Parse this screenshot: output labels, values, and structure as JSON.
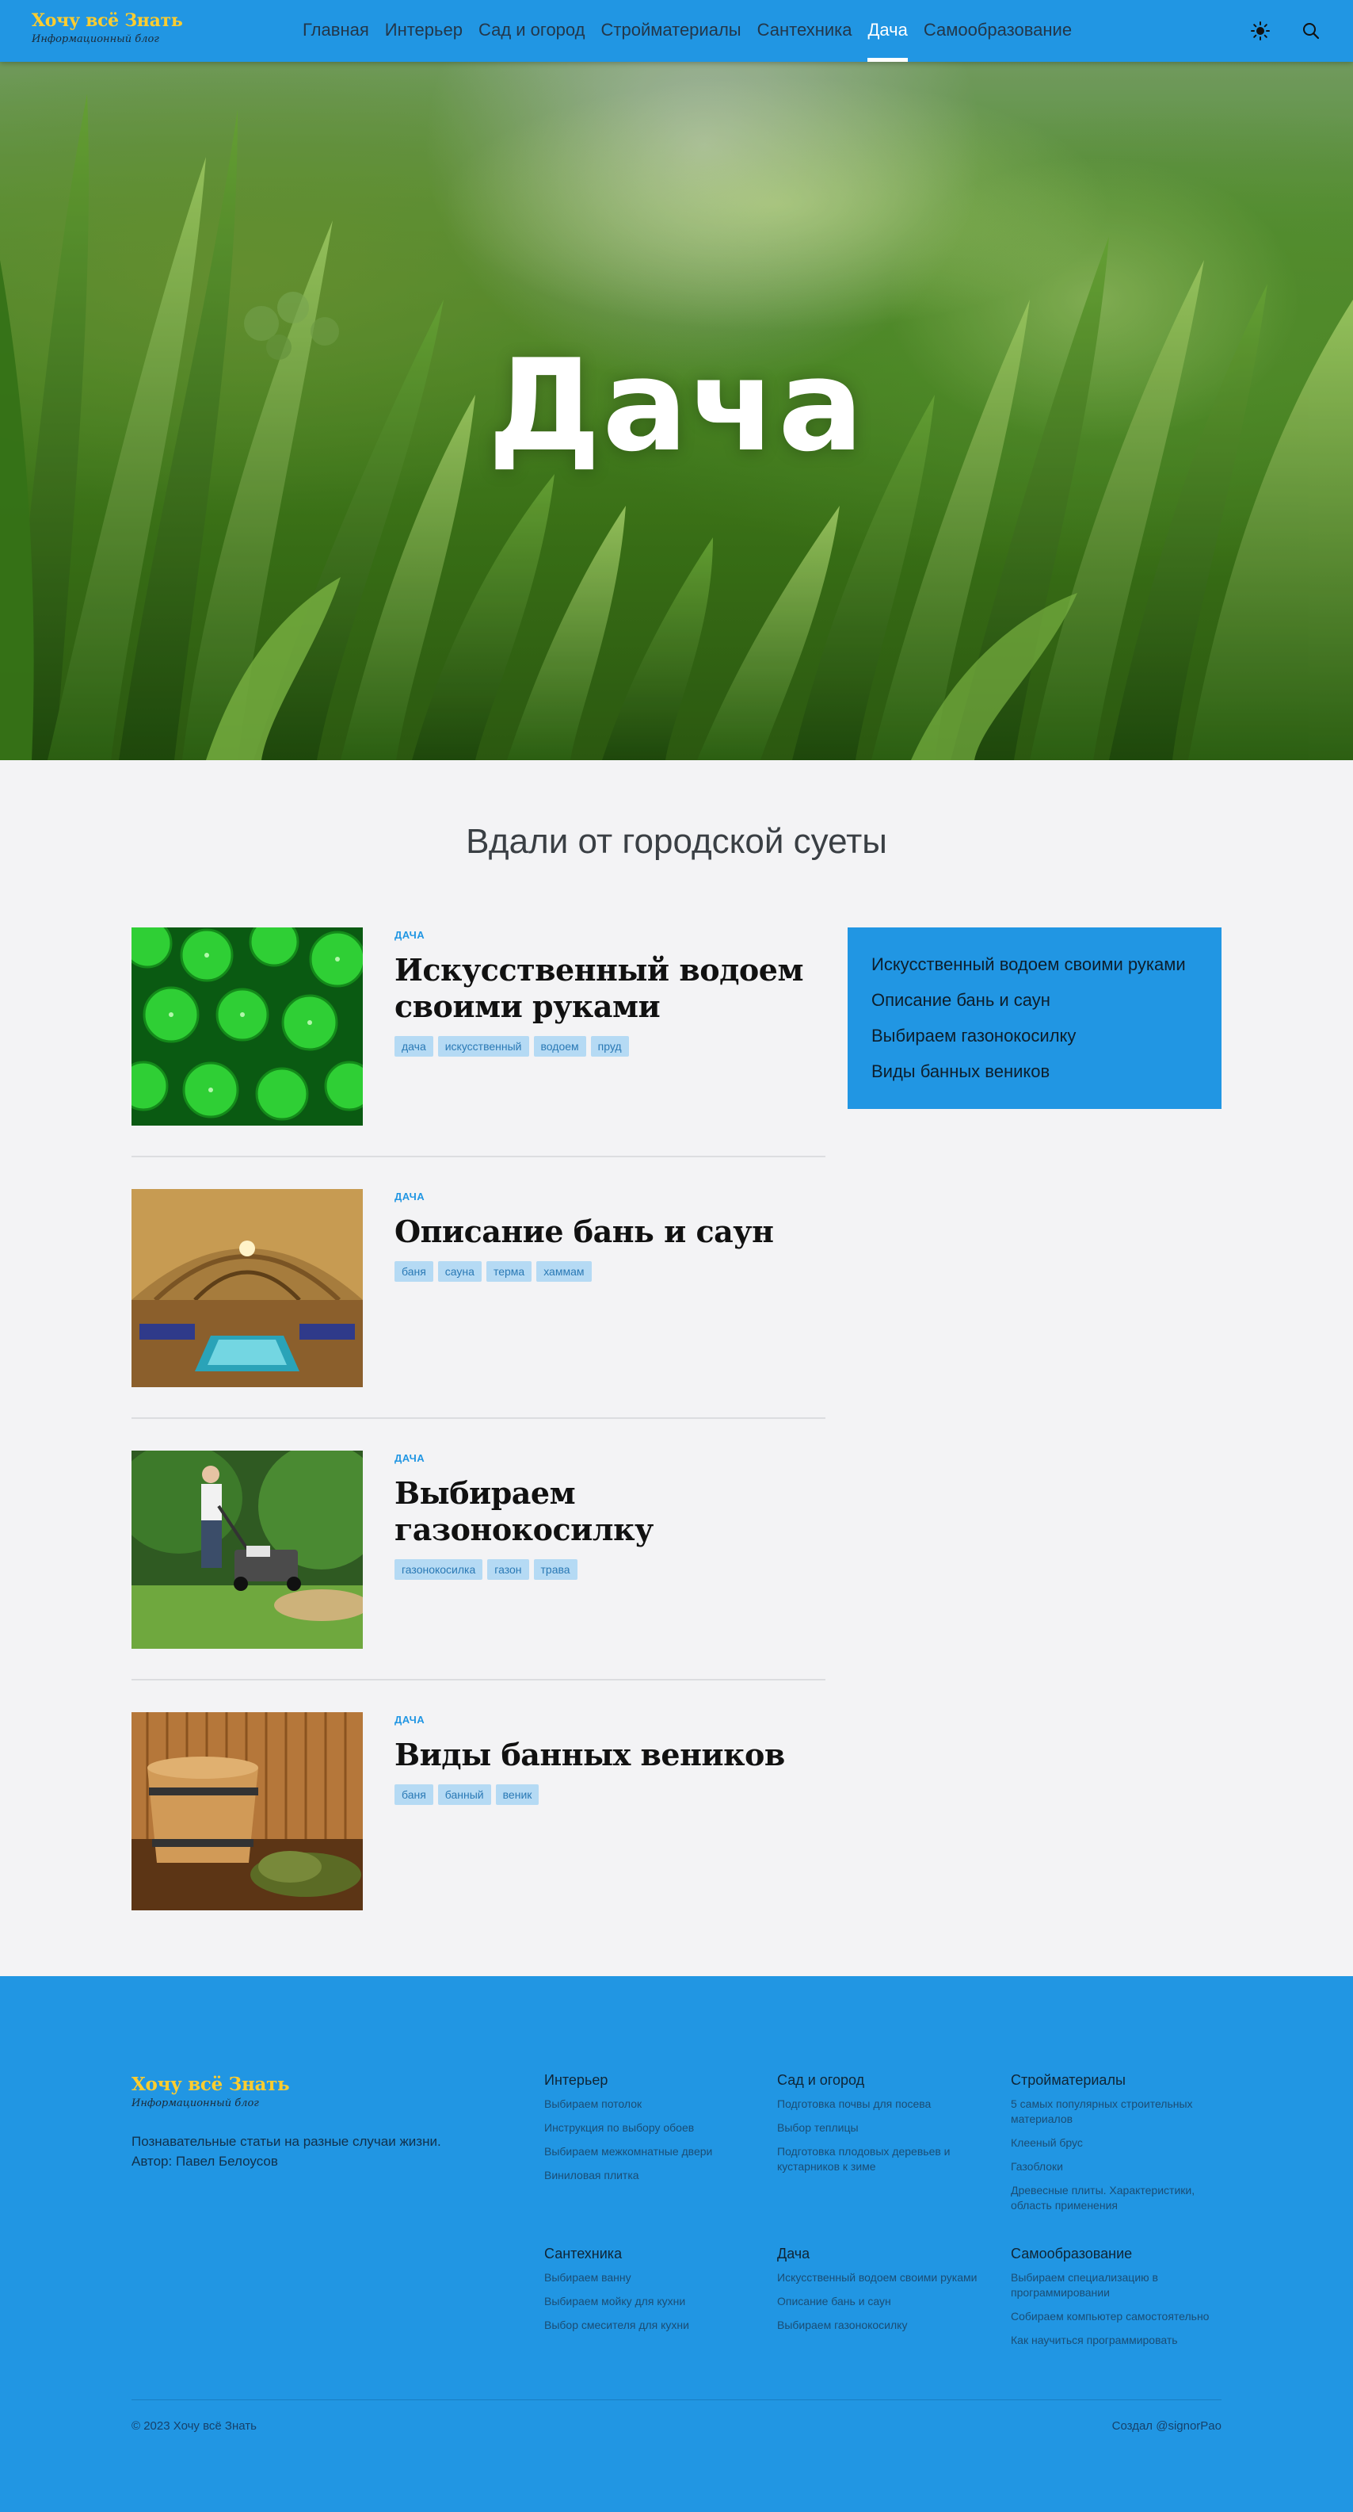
{
  "header": {
    "logo_title": "Хочу всё Знать",
    "logo_subtitle": "Информационный блог",
    "nav": [
      {
        "label": "Главная",
        "active": false
      },
      {
        "label": "Интерьер",
        "active": false
      },
      {
        "label": "Сад и огород",
        "active": false
      },
      {
        "label": "Стройматериалы",
        "active": false
      },
      {
        "label": "Сантехника",
        "active": false
      },
      {
        "label": "Дача",
        "active": true
      },
      {
        "label": "Самообразование",
        "active": false
      }
    ],
    "theme_icon": "sun-icon",
    "search_icon": "search-icon"
  },
  "hero": {
    "title": "Дача"
  },
  "main": {
    "subtitle": "Вдали от городской суеты",
    "articles": [
      {
        "category": "ДАЧА",
        "title": "Искусственный водоем своими руками",
        "tags": [
          "дача",
          "искусственный",
          "водоем",
          "пруд"
        ],
        "image": "water-lettuce-image"
      },
      {
        "category": "ДАЧА",
        "title": "Описание бань и саун",
        "tags": [
          "баня",
          "сауна",
          "терма",
          "хаммам"
        ],
        "image": "bathhouse-image"
      },
      {
        "category": "ДАЧА",
        "title": "Выбираем газонокосилку",
        "tags": [
          "газонокосилка",
          "газон",
          "трава"
        ],
        "image": "lawnmower-image"
      },
      {
        "category": "ДАЧА",
        "title": "Виды банных веников",
        "tags": [
          "баня",
          "банный",
          "веник"
        ],
        "image": "sauna-broom-image"
      }
    ]
  },
  "sidebar": {
    "links": [
      "Искусственный водоем своими руками",
      "Описание бань и саун",
      "Выбираем газонокосилку",
      "Виды банных веников"
    ]
  },
  "footer": {
    "logo_title": "Хочу всё Знать",
    "logo_subtitle": "Информационный блог",
    "description": "Познавательные статьи на разные случаи жизни.",
    "author_prefix": "Автор: ",
    "author": "Павел Белоусов",
    "columns": [
      {
        "title": "Интерьер",
        "links": [
          "Выбираем потолок",
          "Инструкция по выбору обоев",
          "Выбираем межкомнатные двери",
          "Виниловая плитка"
        ]
      },
      {
        "title": "Сад и огород",
        "links": [
          "Подготовка почвы для посева",
          "Выбор теплицы",
          "Подготовка плодовых деревьев и кустарников к зиме"
        ]
      },
      {
        "title": "Стройматериалы",
        "links": [
          "5 самых популярных строительных материалов",
          "Клееный брус",
          "Газоблоки",
          "Древесные плиты. Характеристики, область применения"
        ]
      },
      {
        "title": "Сантехника",
        "links": [
          "Выбираем ванну",
          "Выбираем мойку для кухни",
          "Выбор смесителя для кухни"
        ]
      },
      {
        "title": "Дача",
        "links": [
          "Искусственный водоем своими руками",
          "Описание бань и саун",
          "Выбираем газонокосилку"
        ]
      },
      {
        "title": "Самообразование",
        "links": [
          "Выбираем специализацию в программировании",
          "Собираем компьютер самостоятельно",
          "Как научиться программировать"
        ]
      }
    ],
    "copyright": "© 2023 Хочу всё Знать",
    "made_by": "Создал @signorPao"
  },
  "colors": {
    "accent": "#2196e3",
    "logo": "#ffcd2e",
    "tag_bg": "#b5daf4"
  }
}
